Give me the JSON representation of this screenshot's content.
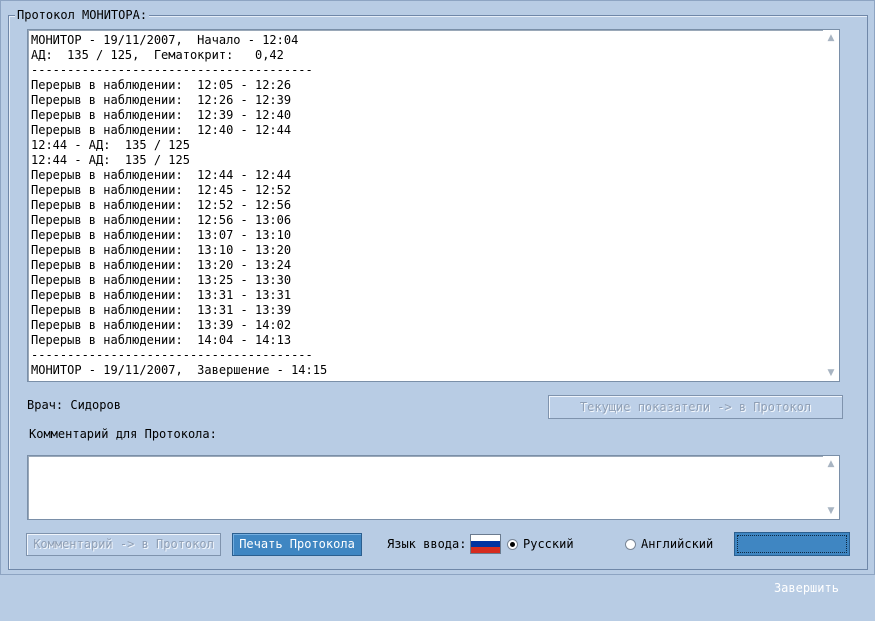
{
  "group_title": "Протокол МОНИТОРА:",
  "log_lines": [
    "МОНИТОР - 19/11/2007,  Начало - 12:04",
    "АД:  135 / 125,  Гематокрит:   0,42",
    "---------------------------------------",
    "Перерыв в наблюдении:  12:05 - 12:26",
    "Перерыв в наблюдении:  12:26 - 12:39",
    "Перерыв в наблюдении:  12:39 - 12:40",
    "Перерыв в наблюдении:  12:40 - 12:44",
    "12:44 - АД:  135 / 125",
    "12:44 - АД:  135 / 125",
    "Перерыв в наблюдении:  12:44 - 12:44",
    "Перерыв в наблюдении:  12:45 - 12:52",
    "Перерыв в наблюдении:  12:52 - 12:56",
    "Перерыв в наблюдении:  12:56 - 13:06",
    "Перерыв в наблюдении:  13:07 - 13:10",
    "Перерыв в наблюдении:  13:10 - 13:20",
    "Перерыв в наблюдении:  13:20 - 13:24",
    "Перерыв в наблюдении:  13:25 - 13:30",
    "Перерыв в наблюдении:  13:31 - 13:31",
    "Перерыв в наблюдении:  13:31 - 13:39",
    "Перерыв в наблюдении:  13:39 - 14:02",
    "Перерыв в наблюдении:  14:04 - 14:13",
    "---------------------------------------",
    "МОНИТОР - 19/11/2007,  Завершение - 14:15"
  ],
  "doctor_label": "Врач: Сидоров",
  "current_to_protocol_button": "Текущие показатели -> в Протокол",
  "comment_label": "Комментарий для Протокола:",
  "comment_value": "",
  "comment_to_protocol_button": "Комментарий -> в Протокол",
  "print_button": "Печать Протокола",
  "language_label": "Язык ввода:",
  "lang_russian": "Русский",
  "lang_english": "Английский",
  "lang_selected": "Русский",
  "finish_button": "Завершить",
  "flag_icon": "russian-flag-icon",
  "colors": {
    "background": "#b8cce4",
    "primary_button": "#3f86c2",
    "flag": [
      "#ffffff",
      "#0033a0",
      "#d52b1e"
    ]
  }
}
